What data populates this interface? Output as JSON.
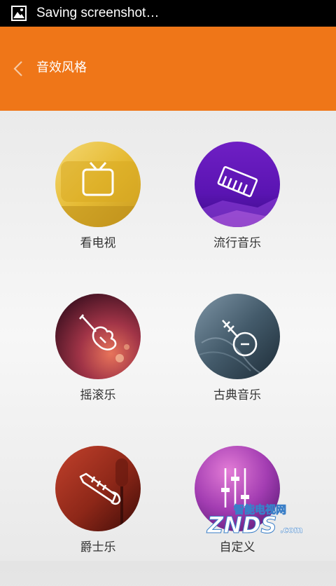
{
  "status_bar": {
    "notification_icon": "image-icon",
    "text": "Saving screenshot…"
  },
  "app_bar": {
    "back_icon": "chevron-left-icon",
    "title": "音效风格",
    "background_color": "#ef7618"
  },
  "styles": [
    {
      "label": "看电视",
      "icon": "tv-icon"
    },
    {
      "label": "流行音乐",
      "icon": "keyboard-icon"
    },
    {
      "label": "摇滚乐",
      "icon": "electric-guitar-icon"
    },
    {
      "label": "古典音乐",
      "icon": "pipa-icon"
    },
    {
      "label": "爵士乐",
      "icon": "trumpet-icon"
    },
    {
      "label": "自定义",
      "icon": "equalizer-sliders-icon"
    }
  ],
  "watermark": {
    "brand": "ZNDS",
    "tagline": "智能电视网",
    "domain": ".com"
  }
}
